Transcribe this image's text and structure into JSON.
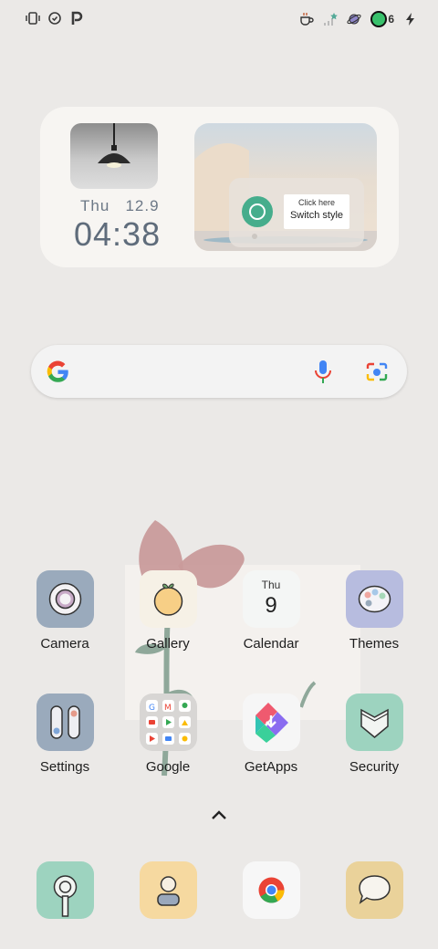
{
  "status_bar": {
    "left_icons": [
      "vibrate-icon",
      "alarm-icon",
      "parking-p-icon"
    ],
    "right_icons": [
      "coffee-icon",
      "signal-icon",
      "planet-icon",
      "battery-icon",
      "charging-bolt-icon"
    ],
    "battery_level": "6"
  },
  "widget": {
    "day": "Thu",
    "date": "12.9",
    "time": "04:38",
    "style_hint": "Click here",
    "style_action": "Switch style"
  },
  "search": {
    "icons": [
      "google-g-icon",
      "microphone-icon",
      "lens-camera-icon"
    ]
  },
  "apps_row1": [
    {
      "label": "Camera",
      "name": "camera"
    },
    {
      "label": "Gallery",
      "name": "gallery"
    },
    {
      "label": "Calendar",
      "name": "calendar",
      "day": "Thu",
      "date": "9"
    },
    {
      "label": "Themes",
      "name": "themes"
    }
  ],
  "apps_row2": [
    {
      "label": "Settings",
      "name": "settings"
    },
    {
      "label": "Google",
      "name": "google-folder"
    },
    {
      "label": "GetApps",
      "name": "getapps"
    },
    {
      "label": "Security",
      "name": "security"
    }
  ],
  "dock": [
    {
      "name": "phone",
      "icon": "phone-icon"
    },
    {
      "name": "contacts",
      "icon": "contacts-icon"
    },
    {
      "name": "chrome",
      "icon": "chrome-icon"
    },
    {
      "name": "messages",
      "icon": "messages-icon"
    }
  ],
  "colors": {
    "background": "#ebe9e7",
    "accent_green": "#46ad8c",
    "text_time": "#5f6c7b"
  }
}
